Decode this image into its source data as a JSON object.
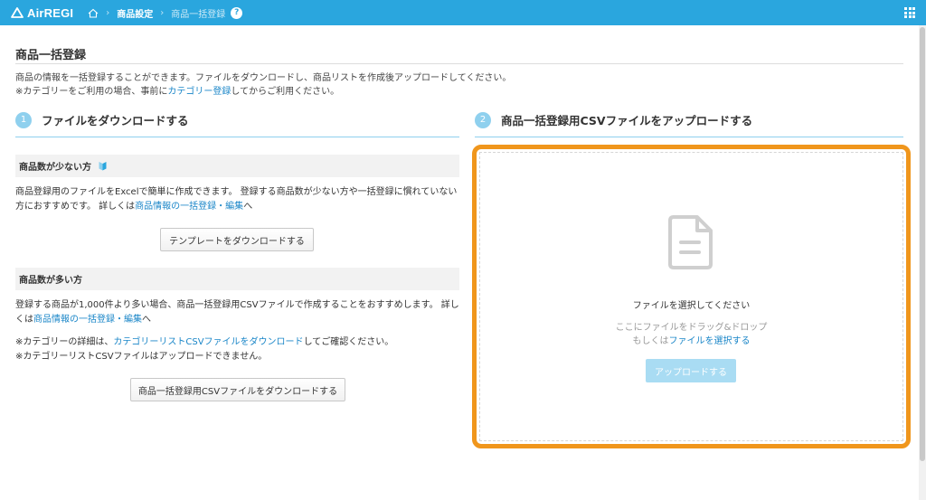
{
  "header": {
    "logo": "AirREGI",
    "breadcrumb": {
      "current": "商品設定",
      "last": "商品一括登録",
      "help": "?"
    }
  },
  "page": {
    "title": "商品一括登録",
    "desc1": "商品の情報を一括登録することができます。ファイルをダウンロードし、商品リストを作成後アップロードしてください。",
    "desc2_pre": "※カテゴリーをご利用の場合、事前に",
    "desc2_link": "カテゴリー登録",
    "desc2_post": "してからご利用ください。"
  },
  "step1": {
    "num": "1",
    "title": "ファイルをダウンロードする",
    "few": {
      "title": "商品数が少ない方",
      "text_pre": "商品登録用のファイルをExcelで簡単に作成できます。 登録する商品数が少ない方や一括登録に慣れていない方におすすめです。 詳しくは",
      "link": "商品情報の一括登録・編集",
      "text_post": "へ",
      "button": "テンプレートをダウンロードする"
    },
    "many": {
      "title": "商品数が多い方",
      "text_pre": "登録する商品が1,000件より多い場合、商品一括登録用CSVファイルで作成することをおすすめします。 詳しくは",
      "link": "商品情報の一括登録・編集",
      "text_post": "へ",
      "note1_pre": "※カテゴリーの詳細は、",
      "note1_link": "カテゴリーリストCSVファイルをダウンロード",
      "note1_post": "してご確認ください。",
      "note2": "※カテゴリーリストCSVファイルはアップロードできません。",
      "button": "商品一括登録用CSVファイルをダウンロードする"
    }
  },
  "step2": {
    "num": "2",
    "title": "商品一括登録用CSVファイルをアップロードする",
    "upload": {
      "title": "ファイルを選択してください",
      "hint1": "ここにファイルをドラッグ&ドロップ",
      "hint2_pre": "もしくは",
      "hint2_link": "ファイルを選択する",
      "button": "アップロードする"
    }
  },
  "colors": {
    "header": "#2aa6de",
    "link": "#1a86c8",
    "highlight": "#f0961c",
    "step_circle": "#8fd0ee"
  }
}
